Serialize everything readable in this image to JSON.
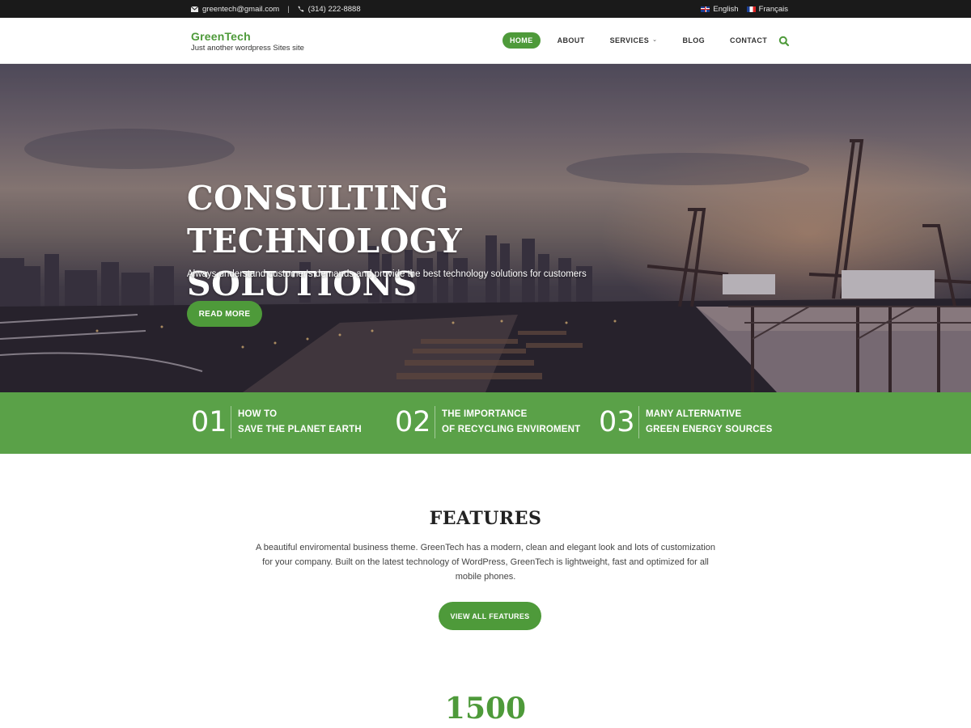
{
  "topbar": {
    "email": "greentech@gmail.com",
    "separator": "|",
    "phone": "(314) 222-8888",
    "languages": [
      {
        "label": "English",
        "flag": "uk-flag-icon"
      },
      {
        "label": "Français",
        "flag": "france-flag-icon"
      }
    ]
  },
  "header": {
    "site_name": "GreenTech",
    "tagline": "Just another wordpress Sites site",
    "nav": [
      {
        "label": "HOME",
        "active": true
      },
      {
        "label": "ABOUT",
        "active": false
      },
      {
        "label": "SERVICES",
        "active": false,
        "has_dropdown": true
      },
      {
        "label": "BLOG",
        "active": false
      },
      {
        "label": "CONTACT",
        "active": false
      }
    ],
    "search_icon": "search-icon"
  },
  "hero": {
    "title_line1": "CONSULTING TECHNOLOGY",
    "title_line2": "SOLUTIONS",
    "subtitle": "Always understand customer's demands and provide the best technology solutions for customers",
    "button": "READ MORE"
  },
  "highlights": [
    {
      "number": "01",
      "line1": "HOW TO",
      "line2": "SAVE THE PLANET EARTH"
    },
    {
      "number": "02",
      "line1": "THE IMPORTANCE",
      "line2": "OF RECYCLING ENVIROMENT"
    },
    {
      "number": "03",
      "line1": "MANY ALTERNATIVE",
      "line2": "GREEN ENERGY SOURCES"
    }
  ],
  "features": {
    "title": "FEATURES",
    "description_line1": "A beautiful enviromental business theme. GreenTech has a modern, clean and elegant look and lots of customization",
    "description_line2": "for your company. Built on the latest technology of WordPress, GreenTech is lightweight, fast and optimized for all",
    "description_line3": "mobile phones.",
    "button": "VIEW ALL FEATURES"
  },
  "stats": {
    "first_value": "1500"
  },
  "colors": {
    "accent": "#4e9a3a",
    "topbar": "#1a1a1a"
  }
}
